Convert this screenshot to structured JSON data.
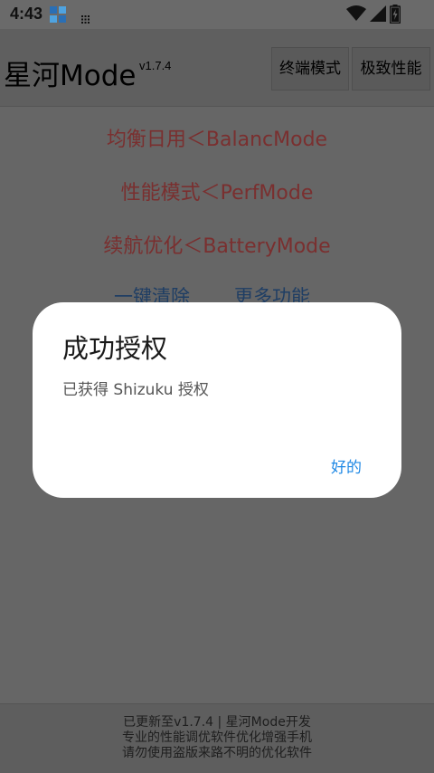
{
  "status_bar": {
    "time": "4:43",
    "icons": [
      "app-notification-icon",
      "grid-notification-icon",
      "wifi-icon",
      "signal-icon",
      "battery-charging-icon"
    ]
  },
  "header": {
    "title": "星河Mode",
    "version": "v1.7.4",
    "buttons": [
      {
        "label": "终端模式"
      },
      {
        "label": "极致性能"
      }
    ]
  },
  "main": {
    "options": [
      {
        "label": "均衡日用＜BalancMode"
      },
      {
        "label": "性能模式＜PerfMode"
      },
      {
        "label": "续航优化＜BatteryMode"
      }
    ],
    "links": [
      {
        "label": "一键清除"
      },
      {
        "label": "更多功能"
      }
    ],
    "option_color": "#7a2f2f",
    "link_color": "#1f3e64"
  },
  "footer": {
    "lines": [
      "已更新至v1.7.4 | 星河Mode开发",
      "专业的性能调优软件优化增强手机",
      "请勿使用盗版来路不明的优化软件"
    ]
  },
  "dialog": {
    "title": "成功授权",
    "message": "已获得 Shizuku 授权",
    "confirm_label": "好的",
    "accent": "#1e88e5"
  }
}
